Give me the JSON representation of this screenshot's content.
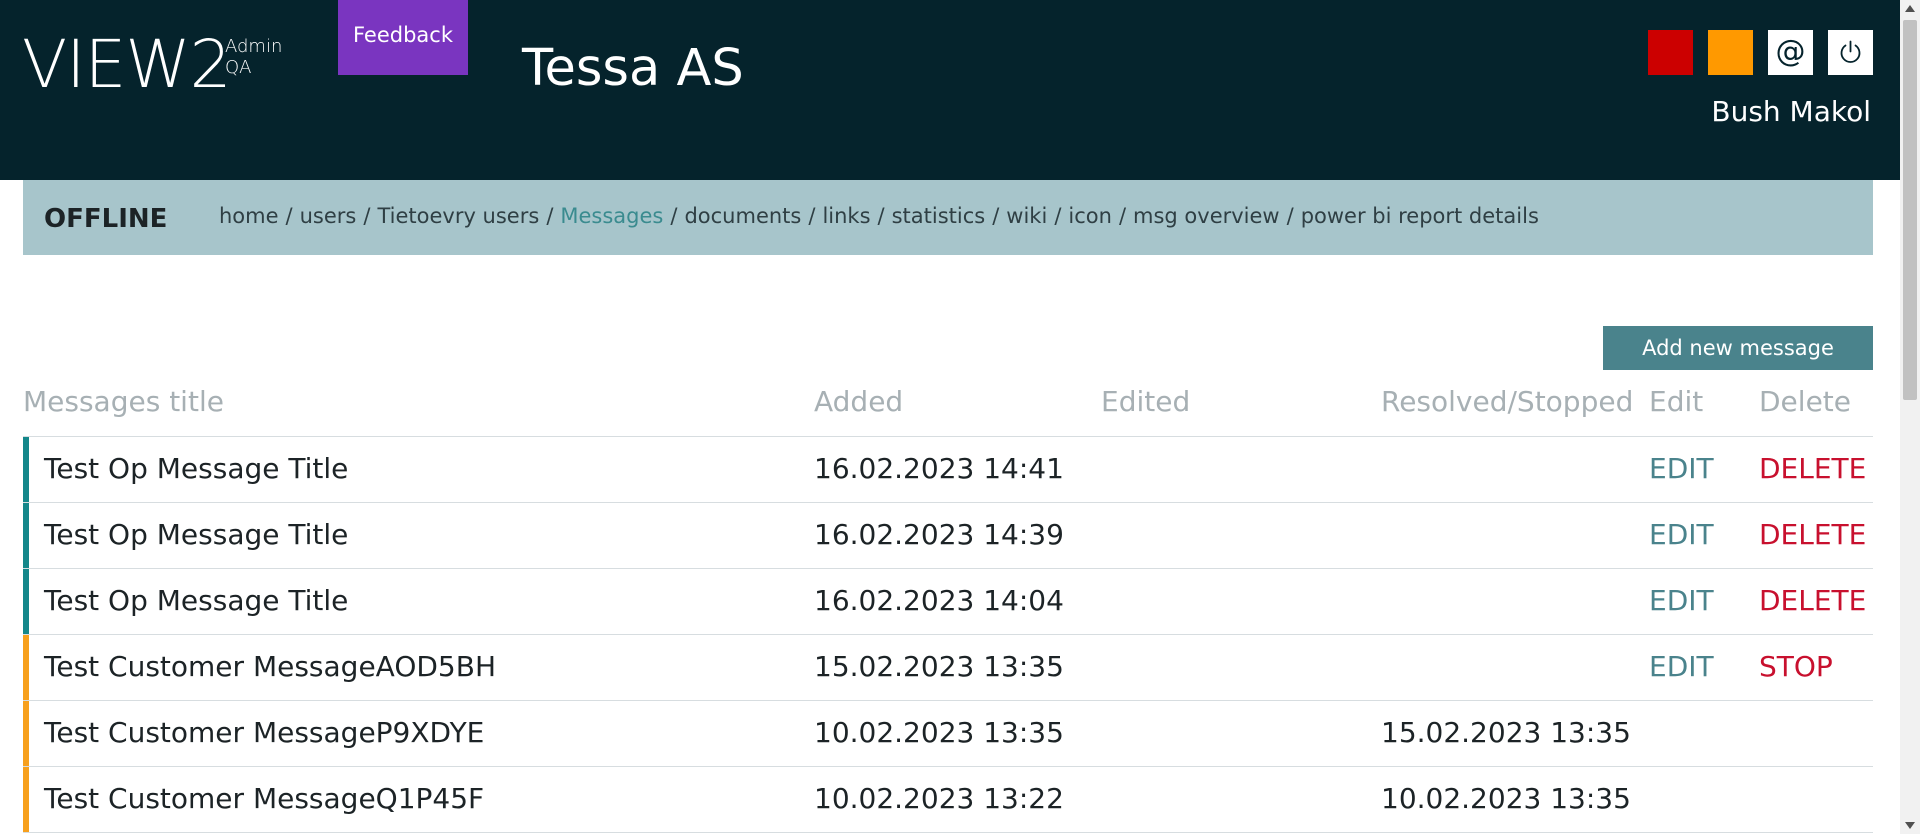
{
  "header": {
    "logo_main": "VIEW2",
    "logo_sub_1": "Admin",
    "logo_sub_2": "QA",
    "feedback_label": "Feedback",
    "org_name": "Tessa AS",
    "at_symbol": "@",
    "user_name": "Bush Makol",
    "status_colors": {
      "red": "#cc0000",
      "orange": "#ff9900"
    },
    "icons": [
      "red-status-square",
      "orange-status-square",
      "at-icon",
      "power-icon"
    ]
  },
  "nav": {
    "status": "OFFLINE",
    "separator": "/",
    "links": [
      {
        "label": "home",
        "active": false
      },
      {
        "label": "users",
        "active": false
      },
      {
        "label": "Tietoevry users",
        "active": false
      },
      {
        "label": "Messages",
        "active": true
      },
      {
        "label": "documents",
        "active": false
      },
      {
        "label": "links",
        "active": false
      },
      {
        "label": "statistics",
        "active": false
      },
      {
        "label": "wiki",
        "active": false
      },
      {
        "label": "icon",
        "active": false
      },
      {
        "label": "msg overview",
        "active": false
      },
      {
        "label": "power bi report details",
        "active": false
      }
    ]
  },
  "actions": {
    "add_message_label": "Add new message"
  },
  "table": {
    "columns": [
      "Messages title",
      "Added",
      "Edited",
      "Resolved/Stopped",
      "Edit",
      "Delete"
    ],
    "rows": [
      {
        "title": "Test Op Message Title",
        "added": "16.02.2023 14:41",
        "edited": "",
        "resolved": "",
        "edit": "EDIT",
        "delete": "DELETE",
        "indicator": "#14878a"
      },
      {
        "title": "Test Op Message Title",
        "added": "16.02.2023 14:39",
        "edited": "",
        "resolved": "",
        "edit": "EDIT",
        "delete": "DELETE",
        "indicator": "#14878a"
      },
      {
        "title": "Test Op Message Title",
        "added": "16.02.2023 14:04",
        "edited": "",
        "resolved": "",
        "edit": "EDIT",
        "delete": "DELETE",
        "indicator": "#14878a"
      },
      {
        "title": "Test Customer MessageAOD5BH",
        "added": "15.02.2023 13:35",
        "edited": "",
        "resolved": "",
        "edit": "EDIT",
        "delete": "STOP",
        "indicator": "#f7a01d"
      },
      {
        "title": "Test Customer MessageP9XDYE",
        "added": "10.02.2023 13:35",
        "edited": "",
        "resolved": "15.02.2023 13:35",
        "edit": "",
        "delete": "",
        "indicator": "#f7a01d"
      },
      {
        "title": "Test Customer MessageQ1P45F",
        "added": "10.02.2023 13:22",
        "edited": "",
        "resolved": "10.02.2023 13:35",
        "edit": "",
        "delete": "",
        "indicator": "#f7a01d"
      }
    ]
  },
  "colors": {
    "header_bg": "#05232c",
    "feedback_bg": "#7a35c0",
    "nav_bg": "#a7c5cb",
    "nav_active": "#3a8b8f",
    "button_bg": "#4a838c",
    "edit_text": "#4a838c",
    "delete_text": "#c8102e"
  }
}
